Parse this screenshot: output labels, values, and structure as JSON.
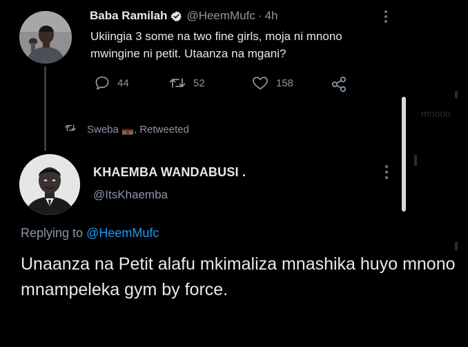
{
  "tweet1": {
    "name": "Baba Ramilah",
    "handle": "@HeemMufc",
    "dot": "·",
    "time": "4h",
    "text": "Ukiingia 3 some na two fine girls, moja ni mnono mwingine ni petit. Utaanza na mgani?",
    "reply_count": "44",
    "retweet_count": "52",
    "like_count": "158"
  },
  "retweet_line": {
    "label_name": "Sweba",
    "label_suffix": ", Retweeted"
  },
  "tweet2": {
    "name": "KHAEMBA WANDABUSI .",
    "handle": "@ItsKhaemba",
    "replying_prefix": "Replying to",
    "replying_mention": "@HeemMufc",
    "text": "Unaanza na Petit alafu mkimaliza mnashika huyo mnono mnampeleka gym by force."
  },
  "background_text": "mnono",
  "icons": {
    "verified": "verified-badge-icon",
    "more": "more-vertical-icon",
    "reply": "reply-icon",
    "retweet": "retweet-icon",
    "like": "heart-icon",
    "share": "share-icon",
    "flag": "kenya-flag-icon"
  },
  "colors": {
    "background": "#000000",
    "text": "#e7e9ea",
    "muted": "#8b98a5",
    "link": "#1d9bf0"
  }
}
